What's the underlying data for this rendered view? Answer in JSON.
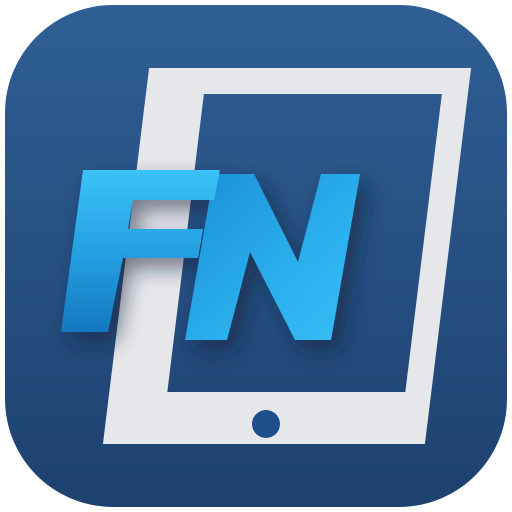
{
  "app_icon": {
    "logo_text": "FN",
    "icon_name": "tablet-icon",
    "colors": {
      "background_top": "#2f5f94",
      "background_bottom": "#1d416f",
      "tablet_frame": "#e6e7ea",
      "home_button": "#1d4f8a",
      "letter_light": "#35b8f1",
      "letter_dark": "#1379c0"
    }
  }
}
